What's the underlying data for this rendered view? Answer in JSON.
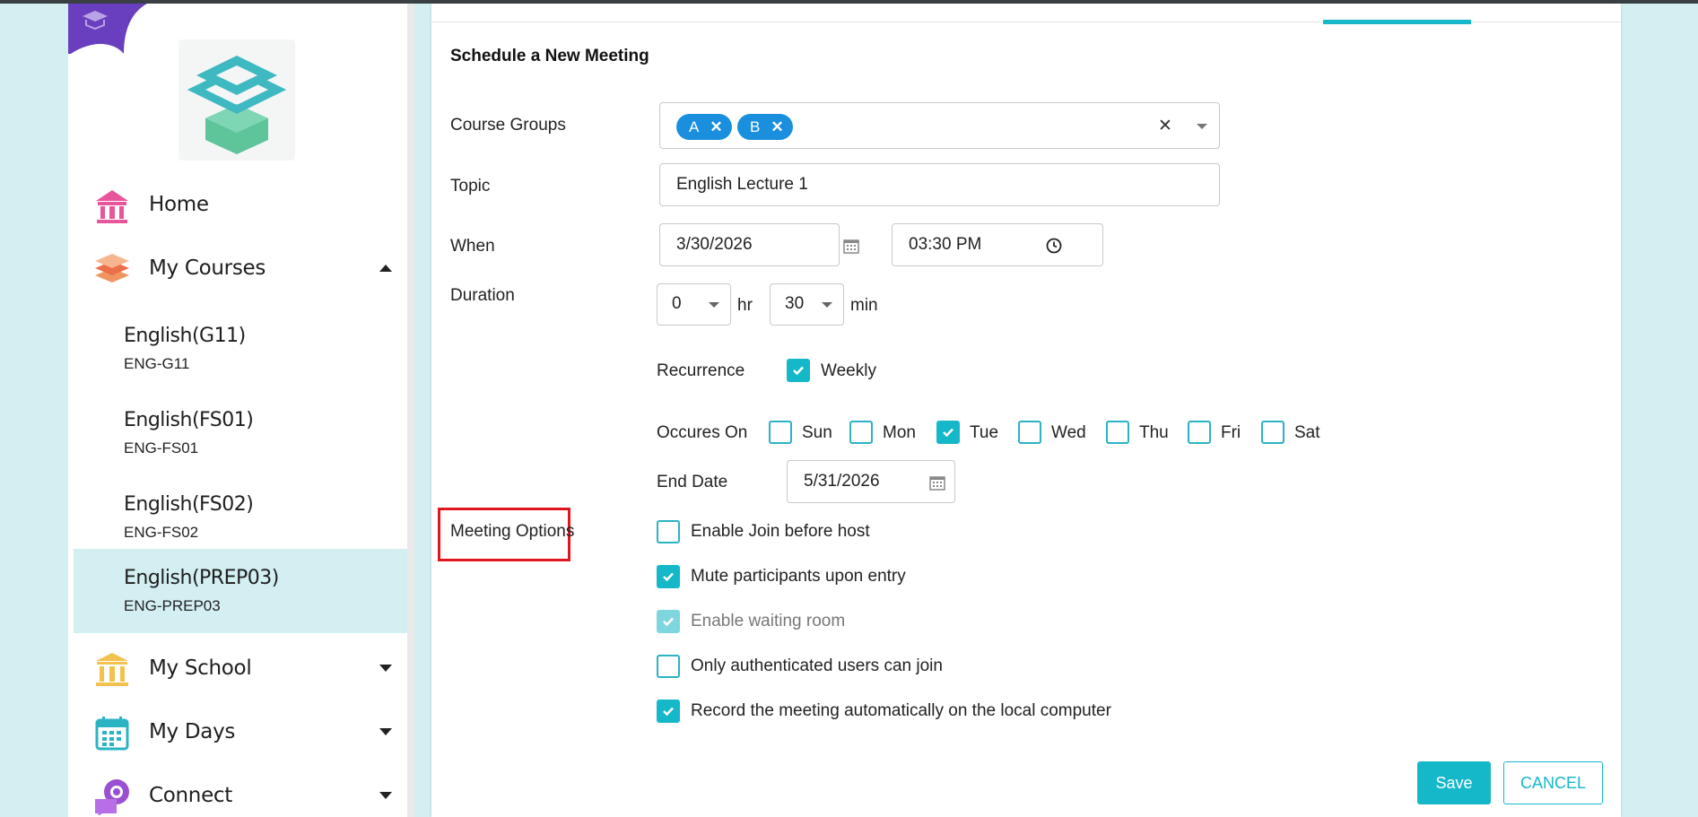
{
  "sidebar": {
    "nav": {
      "home": "Home",
      "my_courses": "My Courses",
      "my_school": "My School",
      "my_days": "My Days",
      "connect": "Connect"
    },
    "courses": [
      {
        "name": "English(G11)",
        "code": "ENG-G11"
      },
      {
        "name": "English(FS01)",
        "code": "ENG-FS01"
      },
      {
        "name": "English(FS02)",
        "code": "ENG-FS02"
      },
      {
        "name": "English(PREP03)",
        "code": "ENG-PREP03"
      }
    ]
  },
  "form": {
    "title": "Schedule a New Meeting",
    "course_groups": {
      "label": "Course Groups",
      "chips": [
        "A",
        "B"
      ],
      "chip_remove": "✕",
      "clear": "✕"
    },
    "topic": {
      "label": "Topic",
      "value": "English Lecture 1"
    },
    "when": {
      "label": "When",
      "date": "3/30/2026",
      "time": "03:30 PM"
    },
    "duration": {
      "label": "Duration",
      "hours": "0",
      "hr_unit": "hr",
      "minutes": "30",
      "min_unit": "min"
    },
    "recurrence": {
      "label": "Recurrence",
      "option": "Weekly",
      "checked": true
    },
    "occurs_on": {
      "label": "Occures On",
      "days": [
        {
          "label": "Sun",
          "checked": false
        },
        {
          "label": "Mon",
          "checked": false
        },
        {
          "label": "Tue",
          "checked": true
        },
        {
          "label": "Wed",
          "checked": false
        },
        {
          "label": "Thu",
          "checked": false
        },
        {
          "label": "Fri",
          "checked": false
        },
        {
          "label": "Sat",
          "checked": false
        }
      ]
    },
    "end_date": {
      "label": "End Date",
      "value": "5/31/2026"
    },
    "meeting_options": {
      "label": "Meeting Options",
      "options": [
        {
          "label": "Enable Join before host",
          "checked": false,
          "disabled": false
        },
        {
          "label": "Mute participants upon entry",
          "checked": true,
          "disabled": false
        },
        {
          "label": "Enable waiting room",
          "checked": true,
          "disabled": true
        },
        {
          "label": "Only authenticated users can join",
          "checked": false,
          "disabled": false
        },
        {
          "label": "Record the meeting automatically on the local computer",
          "checked": true,
          "disabled": false
        }
      ]
    },
    "buttons": {
      "save": "Save",
      "cancel": "CANCEL"
    }
  },
  "colors": {
    "accent": "#15b8c9",
    "chip": "#1a8fde",
    "highlight": "#e0161c",
    "background": "#d3eff2"
  }
}
